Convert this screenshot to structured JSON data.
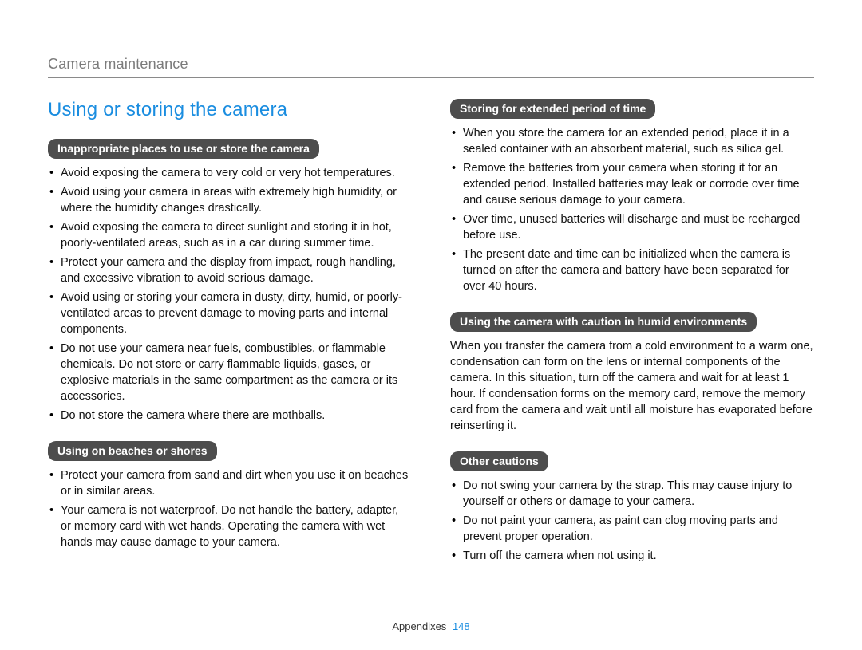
{
  "header": {
    "breadcrumb": "Camera maintenance"
  },
  "main_title": "Using or storing the camera",
  "left": {
    "s1": {
      "heading": "Inappropriate places to use or store the camera",
      "items": [
        "Avoid exposing the camera to very cold or very hot temperatures.",
        "Avoid using your camera in areas with extremely high humidity, or where the humidity changes drastically.",
        "Avoid exposing the camera to direct sunlight and storing it in hot, poorly-ventilated areas, such as in a car during summer time.",
        "Protect your camera and the display from impact, rough handling, and excessive vibration to avoid serious damage.",
        "Avoid using or storing your camera in dusty, dirty, humid, or poorly-ventilated areas to prevent damage to moving parts and internal components.",
        "Do not use your camera near fuels, combustibles, or flammable chemicals. Do not store or carry flammable liquids, gases, or explosive materials in the same compartment as the camera or its accessories.",
        "Do not store the camera where there are mothballs."
      ]
    },
    "s2": {
      "heading": "Using on beaches or shores",
      "items": [
        "Protect your camera from sand and dirt when you use it on beaches or in similar areas.",
        "Your camera is not waterproof. Do not handle the battery, adapter, or memory card with wet hands. Operating the camera with wet hands may cause damage to your camera."
      ]
    }
  },
  "right": {
    "s1": {
      "heading": "Storing for extended period of time",
      "items": [
        "When you store the camera for an extended period, place it in a sealed container with an absorbent material, such as silica gel.",
        "Remove the batteries from your camera when storing it for an extended period. Installed batteries may leak or corrode over time and cause serious damage to your camera.",
        "Over time, unused batteries will discharge and must be recharged before use.",
        "The present date and time can be initialized when the camera is turned on after the camera and battery have been separated for over 40 hours."
      ]
    },
    "s2": {
      "heading": "Using the camera with caution in humid environments",
      "para": "When you transfer the camera from a cold environment to a warm one, condensation can form on the lens or internal components of the camera. In this situation, turn off the camera and wait for at least 1 hour. If condensation forms on the memory card, remove the memory card from the camera and wait until all moisture has evaporated before reinserting it."
    },
    "s3": {
      "heading": "Other cautions",
      "items": [
        "Do not swing your camera by the strap. This may cause injury to yourself or others or damage to your camera.",
        "Do not paint your camera, as paint can clog moving parts and prevent proper operation.",
        "Turn off the camera when not using it."
      ]
    }
  },
  "footer": {
    "section": "Appendixes",
    "page": "148"
  }
}
